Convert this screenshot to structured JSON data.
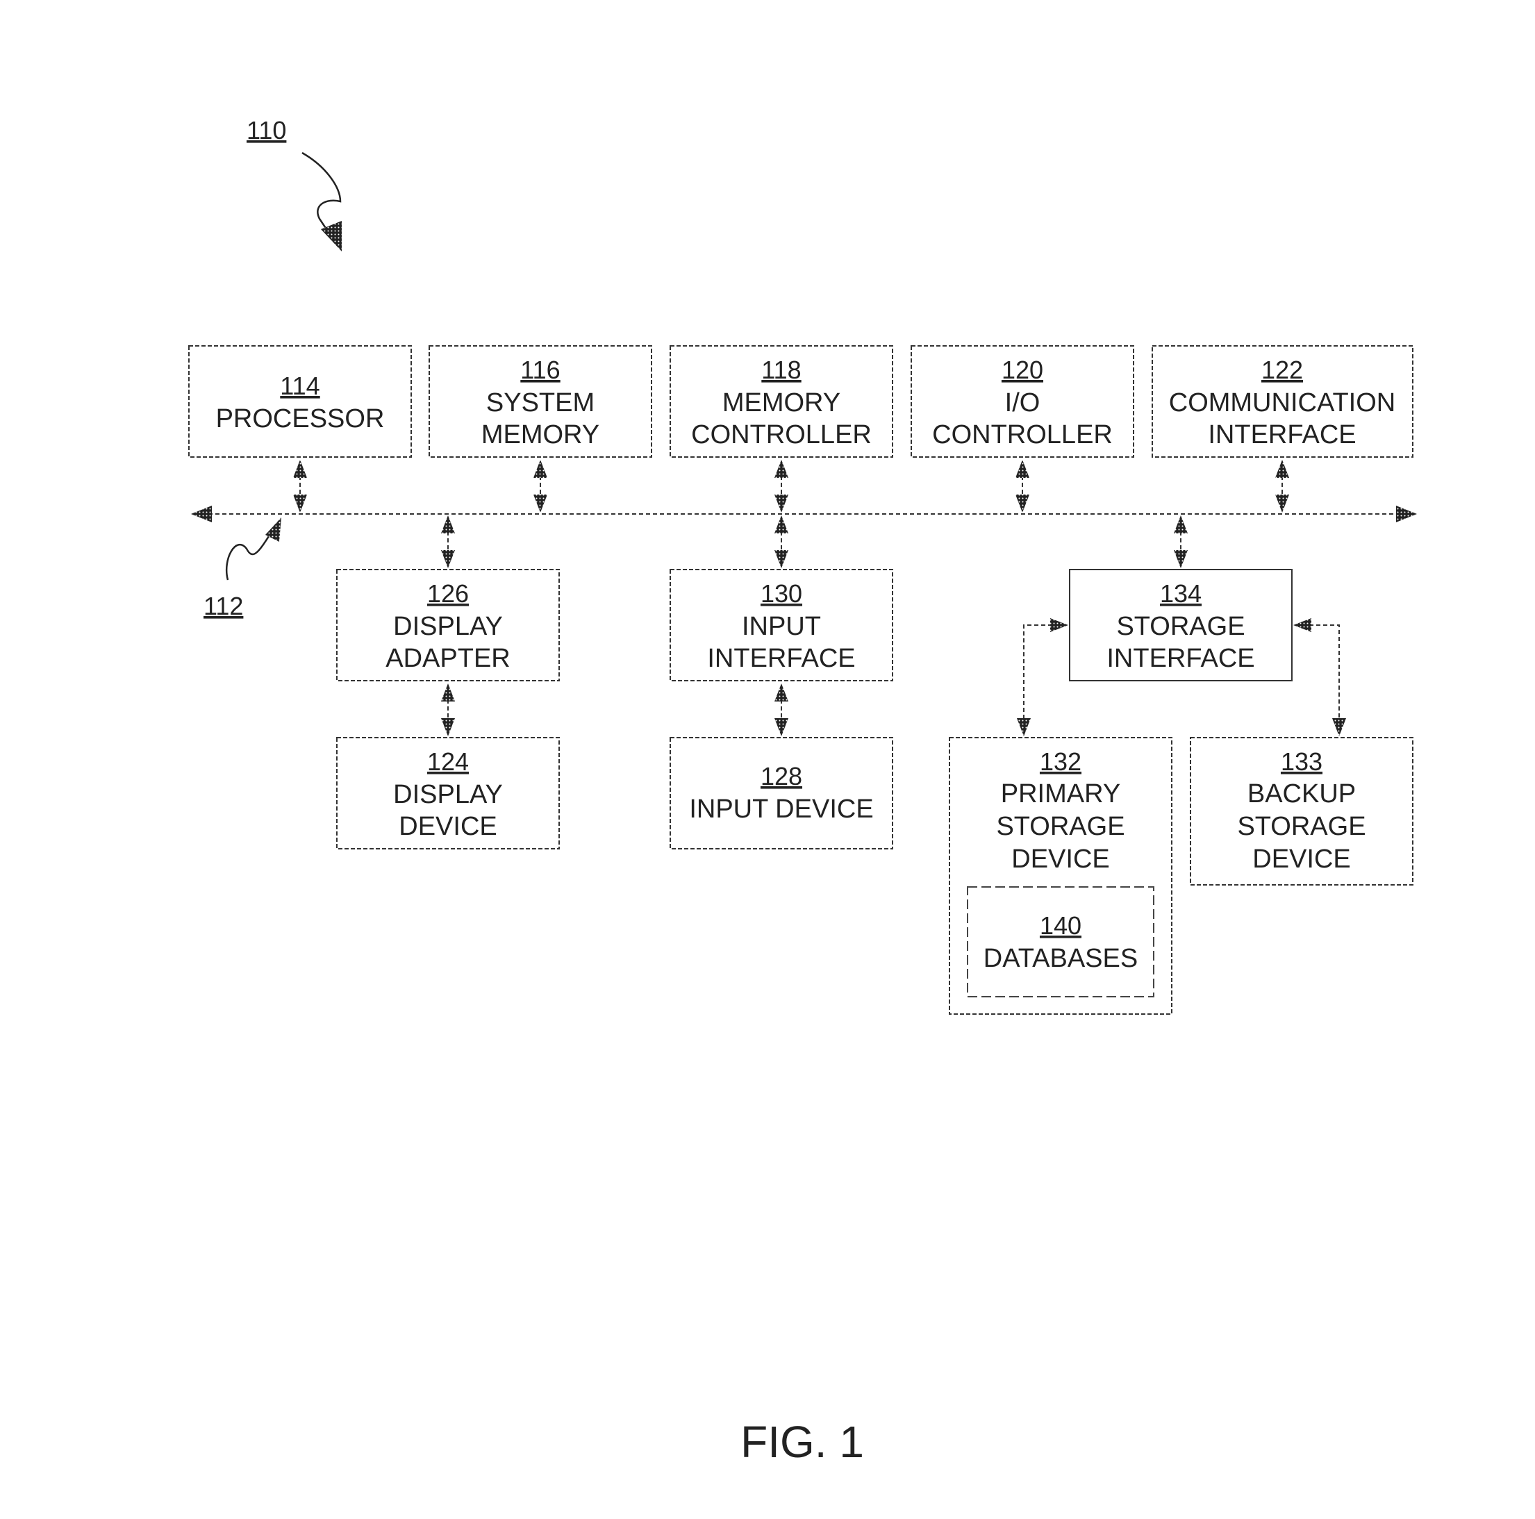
{
  "figure": {
    "caption": "FIG. 1",
    "system_ref": "110",
    "bus_ref": "112"
  },
  "blocks": {
    "processor": {
      "num": "114",
      "lines": [
        "PROCESSOR"
      ]
    },
    "system_memory": {
      "num": "116",
      "lines": [
        "SYSTEM",
        "MEMORY"
      ]
    },
    "memory_controller": {
      "num": "118",
      "lines": [
        "MEMORY",
        "CONTROLLER"
      ]
    },
    "io_controller": {
      "num": "120",
      "lines": [
        "I/O",
        "CONTROLLER"
      ]
    },
    "communication_interface": {
      "num": "122",
      "lines": [
        "COMMUNICATION",
        "INTERFACE"
      ]
    },
    "display_adapter": {
      "num": "126",
      "lines": [
        "DISPLAY",
        "ADAPTER"
      ]
    },
    "input_interface": {
      "num": "130",
      "lines": [
        "INPUT",
        "INTERFACE"
      ]
    },
    "storage_interface": {
      "num": "134",
      "lines": [
        "STORAGE",
        "INTERFACE"
      ]
    },
    "display_device": {
      "num": "124",
      "lines": [
        "DISPLAY",
        "DEVICE"
      ]
    },
    "input_device": {
      "num": "128",
      "lines": [
        "INPUT DEVICE"
      ]
    },
    "primary_storage": {
      "num": "132",
      "lines": [
        "PRIMARY",
        "STORAGE",
        "DEVICE"
      ]
    },
    "backup_storage": {
      "num": "133",
      "lines": [
        "BACKUP",
        "STORAGE",
        "DEVICE"
      ]
    },
    "databases": {
      "num": "140",
      "lines": [
        "DATABASES"
      ]
    }
  }
}
